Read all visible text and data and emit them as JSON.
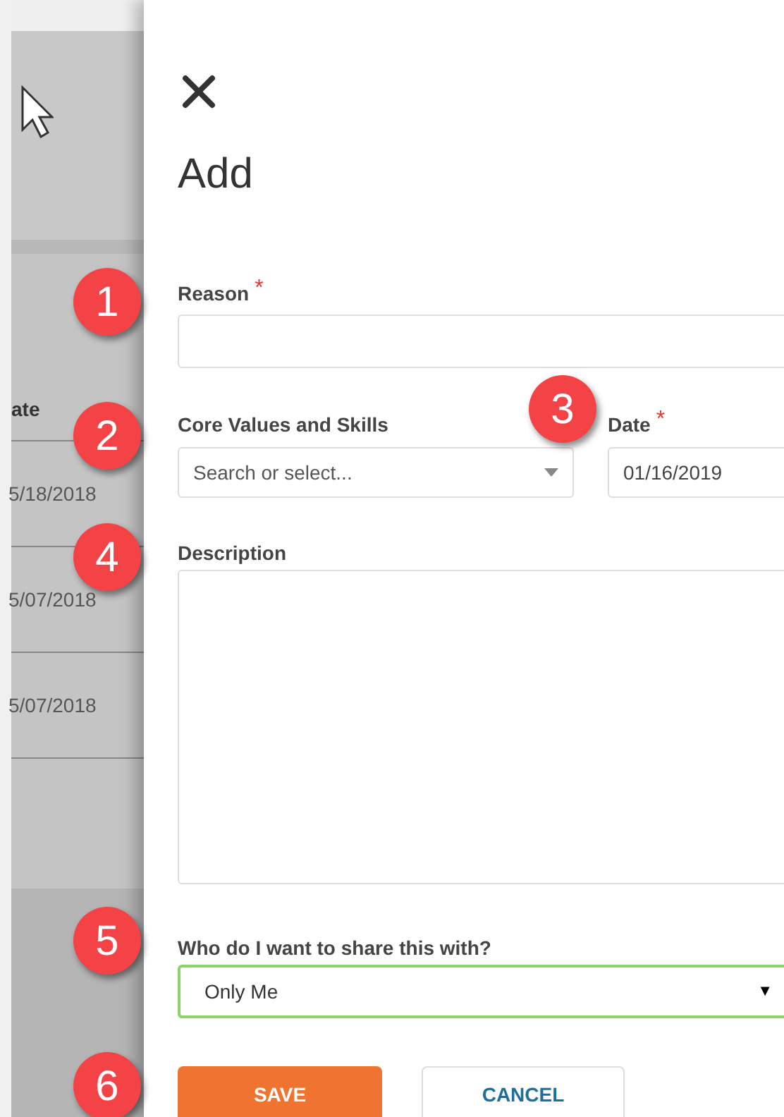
{
  "background_table": {
    "column_header": "ate",
    "rows": [
      "5/18/2018",
      "5/07/2018",
      "5/07/2018"
    ]
  },
  "panel": {
    "title": "Add",
    "fields": [
      {
        "kind": "text",
        "label": "Reason",
        "required_mark": "*"
      },
      {
        "kind": "select",
        "label": "Core Values and Skills",
        "placeholder": "Search or select..."
      },
      {
        "kind": "date",
        "label": "Date",
        "required_mark": "*",
        "value": "01/16/2019"
      },
      {
        "kind": "textarea",
        "label": "Description"
      },
      {
        "kind": "share",
        "label": "Who do I want to share this with?",
        "value": "Only Me",
        "caret": "▼"
      }
    ],
    "buttons": [
      {
        "kind": "primary",
        "label": "SAVE"
      },
      {
        "kind": "secondary",
        "label": "CANCEL"
      }
    ]
  },
  "callouts": [
    "1",
    "2",
    "3",
    "4",
    "5",
    "6"
  ]
}
